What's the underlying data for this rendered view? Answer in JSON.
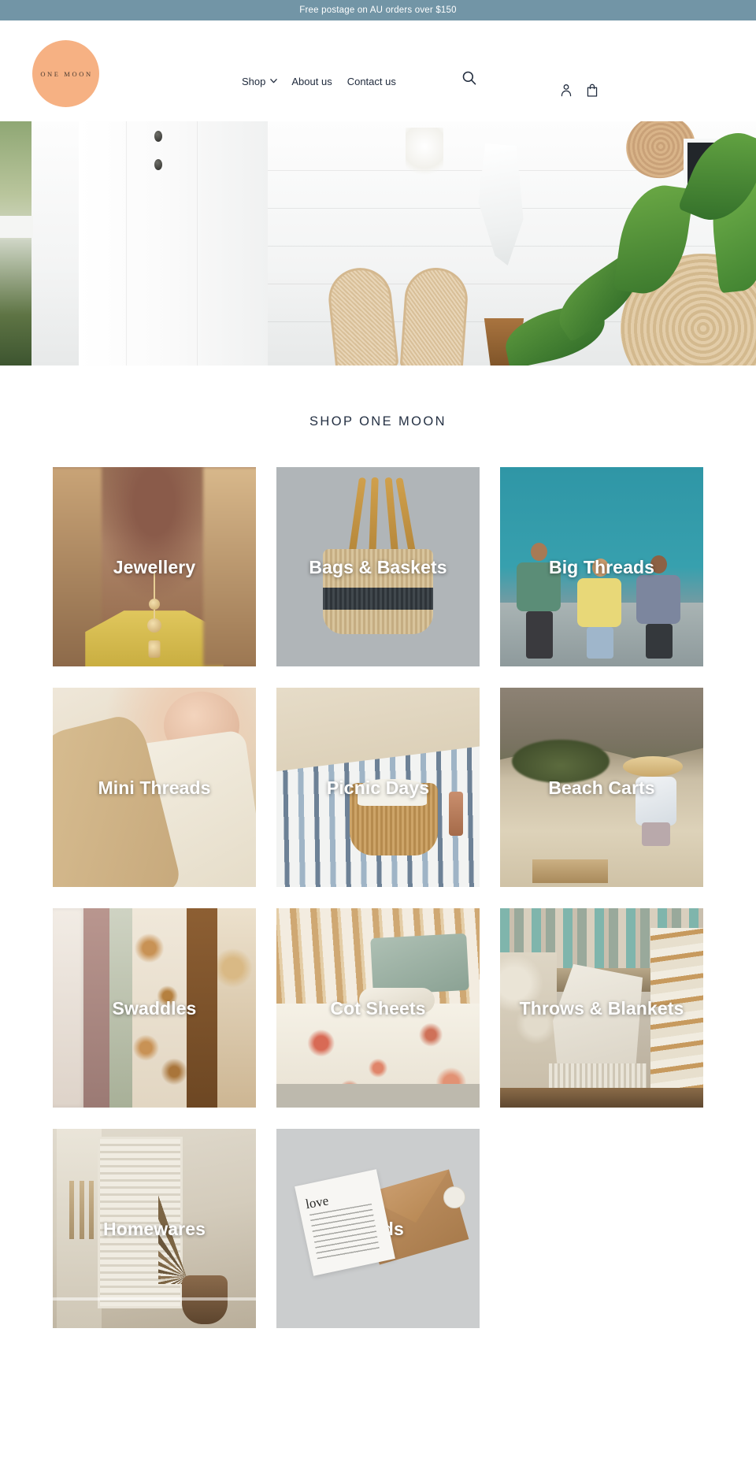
{
  "announcement": {
    "text": "Free postage on AU orders over $150",
    "background": "#7295a6"
  },
  "header": {
    "logo": {
      "text": "ONE MOON",
      "shape": "circle",
      "color": "#f6b183"
    },
    "nav": [
      {
        "label": "Shop",
        "has_dropdown": true
      },
      {
        "label": "About us",
        "has_dropdown": false
      },
      {
        "label": "Contact us",
        "has_dropdown": false
      }
    ],
    "icons": {
      "search": "search-icon",
      "account": "account-icon",
      "cart": "cart-icon"
    }
  },
  "hero": {
    "alt": "Coastal white weatherboard house with rattan chairs, hanging towel and tropical plants"
  },
  "collections": {
    "title": "SHOP ONE MOON",
    "tiles": [
      {
        "label": "Jewellery",
        "art": "art-jewellery"
      },
      {
        "label": "Bags & Baskets",
        "art": "art-bags"
      },
      {
        "label": "Big Threads",
        "art": "art-big"
      },
      {
        "label": "Mini Threads",
        "art": "art-mini"
      },
      {
        "label": "Picnic Days",
        "art": "art-picnic"
      },
      {
        "label": "Beach Carts",
        "art": "art-beach"
      },
      {
        "label": "Swaddles",
        "art": "art-swaddles"
      },
      {
        "label": "Cot Sheets",
        "art": "art-cot"
      },
      {
        "label": "Throws & Blankets",
        "art": "art-throws"
      },
      {
        "label": "Homewares",
        "art": "art-home"
      },
      {
        "label": "Cards",
        "art": "art-cards"
      }
    ]
  },
  "cards_tile": {
    "word": "love"
  },
  "colors": {
    "announcement_bar": "#7295a6",
    "logo_circle": "#f6b183",
    "text_dark": "#202b3d",
    "tile_label": "#ffffff"
  }
}
